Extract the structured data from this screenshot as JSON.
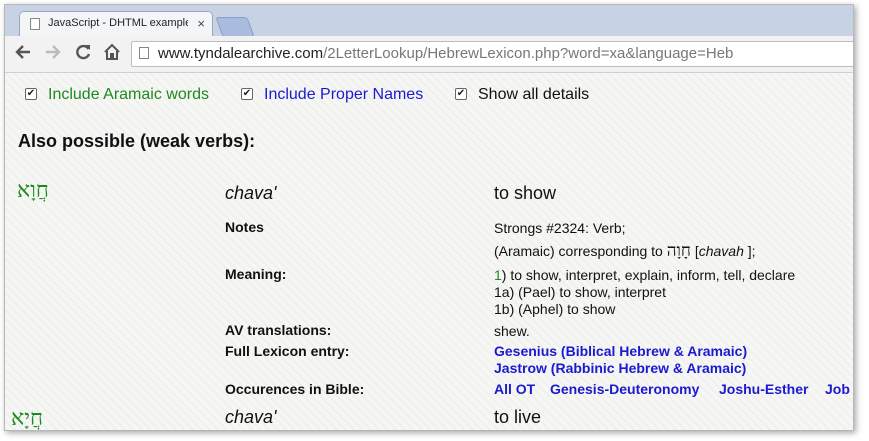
{
  "browser": {
    "tab_title": "JavaScript - DHTML example",
    "tab_close": "×",
    "url_host": "www.tyndalearchive.com",
    "url_path": "/2LetterLookup/HebrewLexicon.php?word=xa&language=Heb"
  },
  "options": {
    "check_mark": "✔",
    "aramaic_label": "Include Aramaic words",
    "proper_names_label": "Include Proper Names",
    "details_label": "Show all details",
    "aramaic_color": "#1d8a1d",
    "proper_names_color": "#1a1ad0"
  },
  "heading": "Also possible (weak verbs):",
  "entry1": {
    "hebrew": "חֲוָא",
    "translit": "chava'",
    "gloss": "to show",
    "notes_label": "Notes",
    "notes_line1": "Strongs #2324: Verb;",
    "notes_line2_prefix": "(Aramaic) corresponding to",
    "notes_line2_hebrew": "חָוָה",
    "notes_line2_open": "[",
    "notes_line2_translit": "chavah",
    "notes_line2_close": "];",
    "meaning_label": "Meaning:",
    "meaning_1_num": "1",
    "meaning_1": ") to show, interpret, explain, inform, tell, declare",
    "meaning_1a": "1a) (Pael) to show, interpret",
    "meaning_1b": "1b) (Aphel) to show",
    "av_label": "AV translations:",
    "av_value": "shew.",
    "lexicon_label": "Full Lexicon entry:",
    "lexicon_link1": "Gesenius (Biblical Hebrew & Aramaic)",
    "lexicon_link2": "Jastrow (Rabbinic Hebrew & Aramaic)",
    "occ_label": "Occurences in Bible:",
    "occ_links": [
      "All OT",
      "Genesis-Deuteronomy",
      "Joshu-Esther",
      "Job"
    ]
  },
  "entry2": {
    "hebrew": "חֲיָא",
    "translit": "chava'",
    "gloss": "to live"
  }
}
